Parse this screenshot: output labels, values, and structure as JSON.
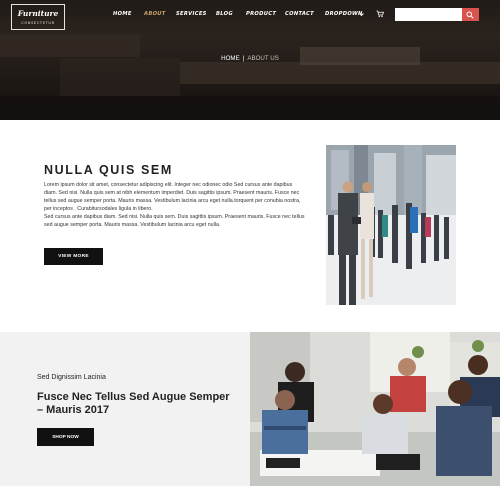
{
  "header": {
    "logo": {
      "title": "Furniture",
      "subtitle": "CONSECTETUR"
    },
    "nav": [
      {
        "label": "HOME",
        "active": false
      },
      {
        "label": "ABOUT",
        "active": true
      },
      {
        "label": "SERVICES",
        "active": false
      },
      {
        "label": "BLOG",
        "active": false
      },
      {
        "label": "PRODUCT",
        "active": false
      },
      {
        "label": "CONTACT",
        "active": false
      },
      {
        "label": "DROPDOWN",
        "active": false
      }
    ],
    "dropdown_icon": "chevron-down-icon",
    "cart_icon": "cart-icon",
    "search": {
      "placeholder": "",
      "value": "",
      "button_icon": "search-icon"
    }
  },
  "breadcrumb": {
    "home": "HOME",
    "separator": "|",
    "current": "ABOUT US"
  },
  "about": {
    "title": "NULLA QUIS SEM",
    "paragraph_1": "Lorem ipsum dolor sit amet, consectetur adipiscing elit. Integer nec odionec odio Sed cursus ante dapibus diam. Sed nisi. Nulla quis sem at nibh elementum imperdiet. Duis sagittis ipsum. Praesent mauris. Fusce nec tellus sed augue semper porta. Mauris massa. Vestibulum lacinia arcu eget nulla.torquent per conubia nostra, per inceptos . Curabitursodales ligula in libero.",
    "paragraph_2": "Sed cursus ante dapibus diam. Sed nisi. Nulla quis sem. Duis sagittis ipsum. Praesent mauris. Fusce nec tellus sed augue semper porta. Mauris massa. Vestibulum lacinia arcu eget nulla.",
    "button": "VIEW MORE"
  },
  "promo": {
    "subtitle": "Sed Dignissim Lacinia",
    "title": "Fusce Nec Tellus Sed Augue Semper – Mauris 2017",
    "button": "SHOP NOW"
  },
  "colors": {
    "accent": "#d9534f",
    "active_nav": "#c9a56a",
    "button_bg": "#111111",
    "promo_bg": "#f2f2f2"
  }
}
